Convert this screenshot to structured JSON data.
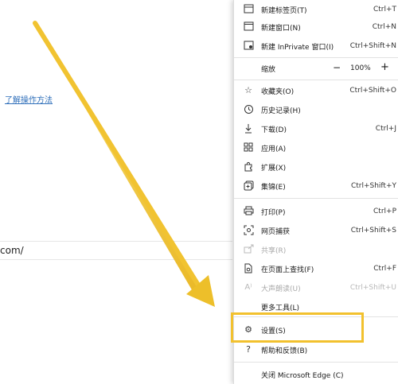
{
  "page": {
    "link_text": "了解操作方法",
    "url_text": "com/"
  },
  "menu": {
    "new_tab": {
      "label": "新建标签页(T)",
      "shortcut": "Ctrl+T"
    },
    "new_window": {
      "label": "新建窗口(N)",
      "shortcut": "Ctrl+N"
    },
    "new_inprivate": {
      "label": "新建 InPrivate 窗口(I)",
      "shortcut": "Ctrl+Shift+N"
    },
    "zoom": {
      "label": "缩放",
      "minus": "−",
      "value": "100%",
      "plus": "+"
    },
    "favorites": {
      "label": "收藏夹(O)",
      "shortcut": "Ctrl+Shift+O"
    },
    "history": {
      "label": "历史记录(H)",
      "shortcut": ""
    },
    "downloads": {
      "label": "下载(D)",
      "shortcut": "Ctrl+J"
    },
    "apps": {
      "label": "应用(A)",
      "shortcut": ""
    },
    "extensions": {
      "label": "扩展(X)",
      "shortcut": ""
    },
    "collections": {
      "label": "集锦(E)",
      "shortcut": "Ctrl+Shift+Y"
    },
    "print": {
      "label": "打印(P)",
      "shortcut": "Ctrl+P"
    },
    "web_capture": {
      "label": "网页捕获",
      "shortcut": "Ctrl+Shift+S"
    },
    "share": {
      "label": "共享(R)",
      "shortcut": ""
    },
    "find": {
      "label": "在页面上查找(F)",
      "shortcut": "Ctrl+F"
    },
    "read_aloud": {
      "label": "大声朗读(U)",
      "shortcut": "Ctrl+Shift+U"
    },
    "more_tools": {
      "label": "更多工具(L)",
      "shortcut": ""
    },
    "settings": {
      "label": "设置(S)",
      "shortcut": ""
    },
    "help": {
      "label": "帮助和反馈(B)",
      "shortcut": ""
    },
    "close": {
      "label": "关闭 Microsoft Edge (C)",
      "shortcut": ""
    }
  },
  "colors": {
    "highlight": "#f2c12e",
    "arrow": "#f2c12e"
  }
}
